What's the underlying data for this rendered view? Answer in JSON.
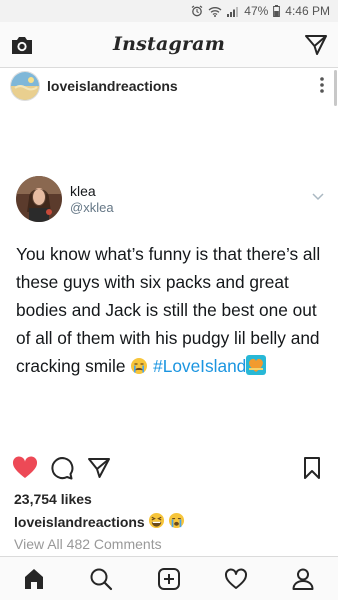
{
  "status_bar": {
    "battery": "47%",
    "time": "4:46 PM"
  },
  "header": {
    "logo": "Instagram"
  },
  "post": {
    "username": "loveislandreactions",
    "tweet": {
      "name": "klea",
      "handle": "@xklea",
      "text": "You know what’s funny is that there’s all these guys with six packs and great bodies and Jack is still the best one out of all of them with his pudgy lil belly and cracking smile ",
      "hashtag": "#LoveIsland"
    },
    "likes": "23,754 likes",
    "caption_user": "loveislandreactions",
    "view_comments": "View All 482 Comments",
    "liked": true
  },
  "icons": [
    "camera-icon",
    "direct-message-icon",
    "more-options-icon",
    "heart-icon",
    "comment-icon",
    "share-icon",
    "bookmark-icon",
    "home-icon",
    "search-icon",
    "new-post-icon",
    "activity-icon",
    "profile-icon"
  ],
  "colors": {
    "like_red": "#ed4956",
    "hashtag_blue": "#1b95e0",
    "muted": "#999999"
  }
}
